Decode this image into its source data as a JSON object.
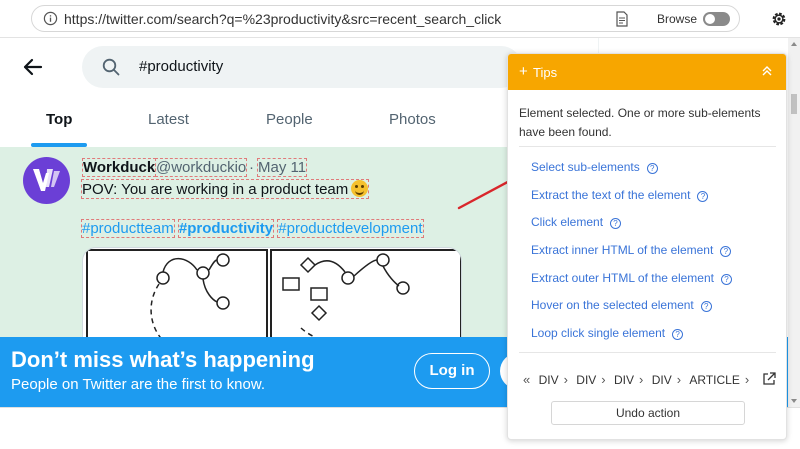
{
  "browser": {
    "url": "https://twitter.com/search?q=%23productivity&src=recent_search_click",
    "browse_label": "Browse"
  },
  "search": {
    "query": "#productivity"
  },
  "tabs": [
    {
      "label": "Top"
    },
    {
      "label": "Latest"
    },
    {
      "label": "People"
    },
    {
      "label": "Photos"
    }
  ],
  "tweet": {
    "name": "Workduck",
    "handle": "@workduckio",
    "separator": "·",
    "date": "May 11",
    "text": "POV: You are working in a product team",
    "hashtags": [
      "#productteam",
      "#productivity",
      "#productdevelopment"
    ]
  },
  "banner": {
    "title": "Don’t miss what’s happening",
    "subtitle": "People on Twitter are the first to know.",
    "login": "Log in"
  },
  "tips": {
    "header": "Tips",
    "message": "Element selected. One or more sub-elements have been found.",
    "actions": [
      "Select sub-elements",
      "Extract the text of the element",
      "Click element",
      "Extract inner HTML of the element",
      "Extract outer HTML of the element",
      "Hover on the selected element",
      "Loop click single element"
    ],
    "breadcrumbs": [
      "DIV",
      "DIV",
      "DIV",
      "DIV",
      "ARTICLE"
    ],
    "undo": "Undo action",
    "accent": "#f7a600",
    "link_color": "#3a74d8"
  },
  "colors": {
    "twitter_blue": "#1d9bf0",
    "tweet_highlight": "#ddf0e4"
  }
}
